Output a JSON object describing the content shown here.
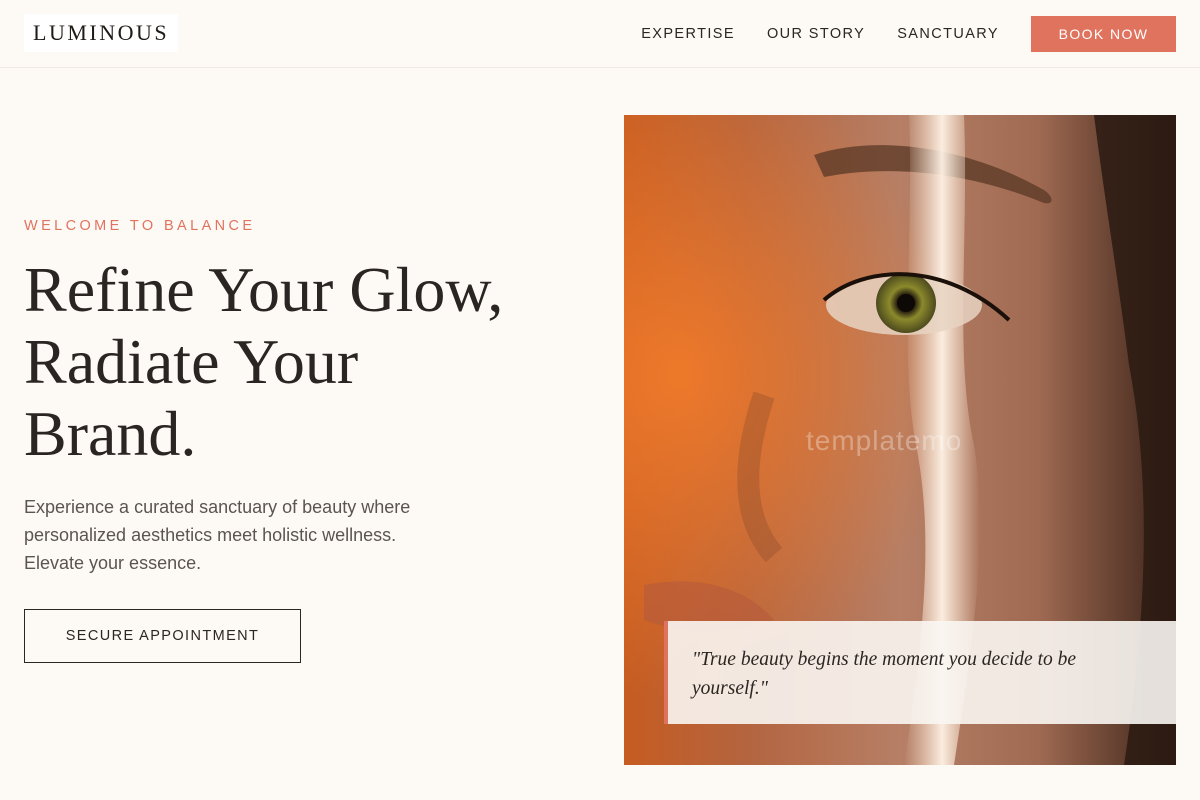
{
  "header": {
    "logo": "LUMINOUS",
    "nav": [
      {
        "label": "EXPERTISE"
      },
      {
        "label": "OUR STORY"
      },
      {
        "label": "SANCTUARY"
      }
    ],
    "cta_label": "BOOK NOW"
  },
  "hero": {
    "eyebrow": "WELCOME TO BALANCE",
    "headline_lines": [
      "Refine Your Glow,",
      "Radiate Your",
      "Brand."
    ],
    "subtext_lines": [
      "Experience a curated sanctuary of beauty where",
      "personalized aesthetics meet holistic wellness.",
      "Elevate your essence."
    ],
    "button_label": "SECURE APPOINTMENT",
    "image": {
      "watermark": "templatemo",
      "quote": "\"True beauty begins the moment you decide to be yourself.\""
    }
  },
  "colors": {
    "accent": "#e0735e",
    "background": "#fdfaf6",
    "text": "#2b2622"
  }
}
